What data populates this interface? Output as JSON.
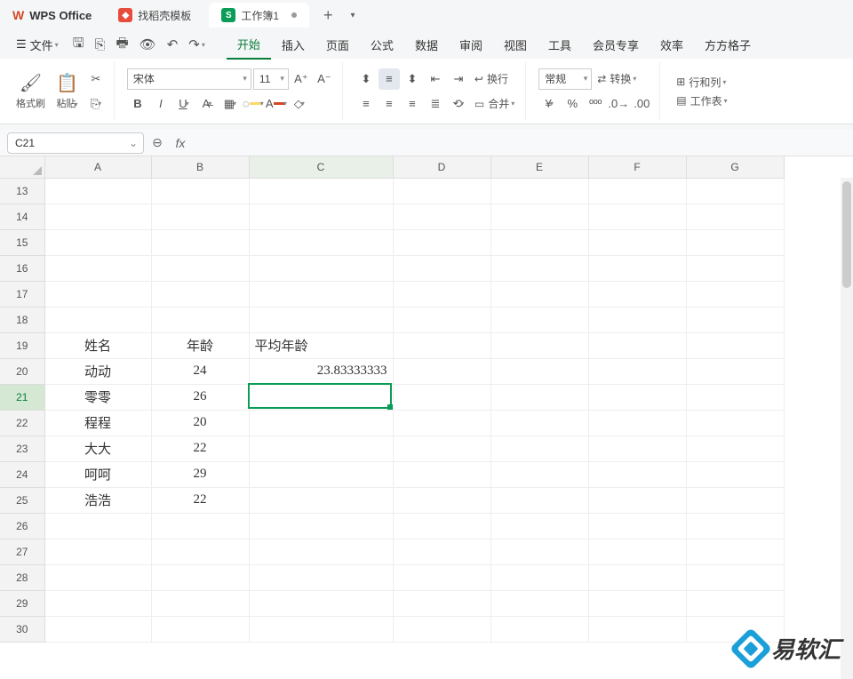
{
  "titlebar": {
    "brand": "WPS Office",
    "tabs": [
      {
        "label": "找稻壳模板",
        "icon": "d",
        "active": false
      },
      {
        "label": "工作簿1",
        "icon": "s",
        "active": true
      }
    ]
  },
  "menu": {
    "file": "文件",
    "tabs": [
      "开始",
      "插入",
      "页面",
      "公式",
      "数据",
      "审阅",
      "视图",
      "工具",
      "会员专享",
      "效率",
      "方方格子"
    ],
    "active": "开始"
  },
  "ribbon": {
    "format_painter": "格式刷",
    "paste": "粘贴",
    "font_name": "宋体",
    "font_size": "11",
    "wrap": "换行",
    "merge": "合并",
    "number_format": "常规",
    "convert": "转换",
    "rowcol": "行和列",
    "sheet": "工作表"
  },
  "fx": {
    "name_box": "C21",
    "formula": ""
  },
  "grid": {
    "columns": [
      "A",
      "B",
      "C",
      "D",
      "E",
      "F",
      "G"
    ],
    "first_row": 13,
    "last_row": 30,
    "active_col": "C",
    "active_row": 21,
    "cells": {
      "A19": "姓名",
      "B19": "年龄",
      "C19": "平均年龄",
      "A20": "动动",
      "B20": "24",
      "C20": "23.83333333",
      "A21": "零零",
      "B21": "26",
      "A22": "程程",
      "B22": "20",
      "A23": "大大",
      "B23": "22",
      "A24": "呵呵",
      "B24": "29",
      "A25": "浩浩",
      "B25": "22"
    }
  },
  "watermark": "易软汇"
}
